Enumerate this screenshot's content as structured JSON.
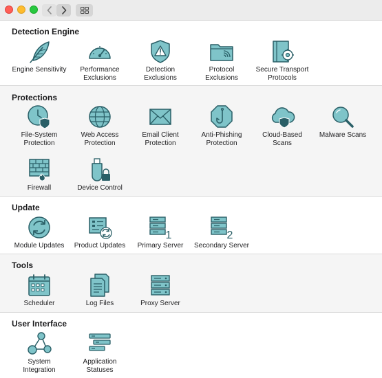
{
  "window": {
    "controls": [
      "close",
      "minimize",
      "maximize"
    ],
    "toolbar": {
      "back_icon": "chevron-left-icon",
      "forward_icon": "chevron-right-icon",
      "grid_icon": "grid-icon"
    }
  },
  "colors": {
    "icon_fill": "#7fc4c9",
    "icon_stroke": "#2a5f67",
    "accent": "#4a9aa3"
  },
  "sections": [
    {
      "title": "Detection Engine",
      "items": [
        {
          "label": "Engine Sensitivity",
          "icon": "feather-icon"
        },
        {
          "label": "Performance\nExclusions",
          "icon": "speedometer-icon"
        },
        {
          "label": "Detection\nExclusions",
          "icon": "shield-warning-icon"
        },
        {
          "label": "Protocol\nExclusions",
          "icon": "folder-signal-icon"
        },
        {
          "label": "Secure Transport\nProtocols",
          "icon": "book-gear-icon"
        }
      ]
    },
    {
      "title": "Protections",
      "items": [
        {
          "label": "File-System\nProtection",
          "icon": "clock-shield-icon"
        },
        {
          "label": "Web Access\nProtection",
          "icon": "globe-icon"
        },
        {
          "label": "Email Client\nProtection",
          "icon": "envelope-icon"
        },
        {
          "label": "Anti-Phishing\nProtection",
          "icon": "hook-octagon-icon"
        },
        {
          "label": "Cloud-Based\nScans",
          "icon": "cloud-shield-icon"
        },
        {
          "label": "Malware Scans",
          "icon": "magnifier-icon"
        },
        {
          "label": "Firewall",
          "icon": "firewall-icon"
        },
        {
          "label": "Device Control",
          "icon": "usb-lock-icon"
        }
      ]
    },
    {
      "title": "Update",
      "items": [
        {
          "label": "Module Updates",
          "icon": "refresh-icon"
        },
        {
          "label": "Product Updates",
          "icon": "panel-refresh-icon"
        },
        {
          "label": "Primary Server",
          "icon": "server-one-icon",
          "badge": "1"
        },
        {
          "label": "Secondary Server",
          "icon": "server-two-icon",
          "badge": "2"
        }
      ]
    },
    {
      "title": "Tools",
      "items": [
        {
          "label": "Scheduler",
          "icon": "calendar-icon"
        },
        {
          "label": "Log Files",
          "icon": "documents-icon"
        },
        {
          "label": "Proxy Server",
          "icon": "server-icon"
        }
      ]
    },
    {
      "title": "User Interface",
      "items": [
        {
          "label": "System\nIntegration",
          "icon": "network-nodes-icon"
        },
        {
          "label": "Application\nStatuses",
          "icon": "status-list-icon"
        }
      ]
    }
  ]
}
